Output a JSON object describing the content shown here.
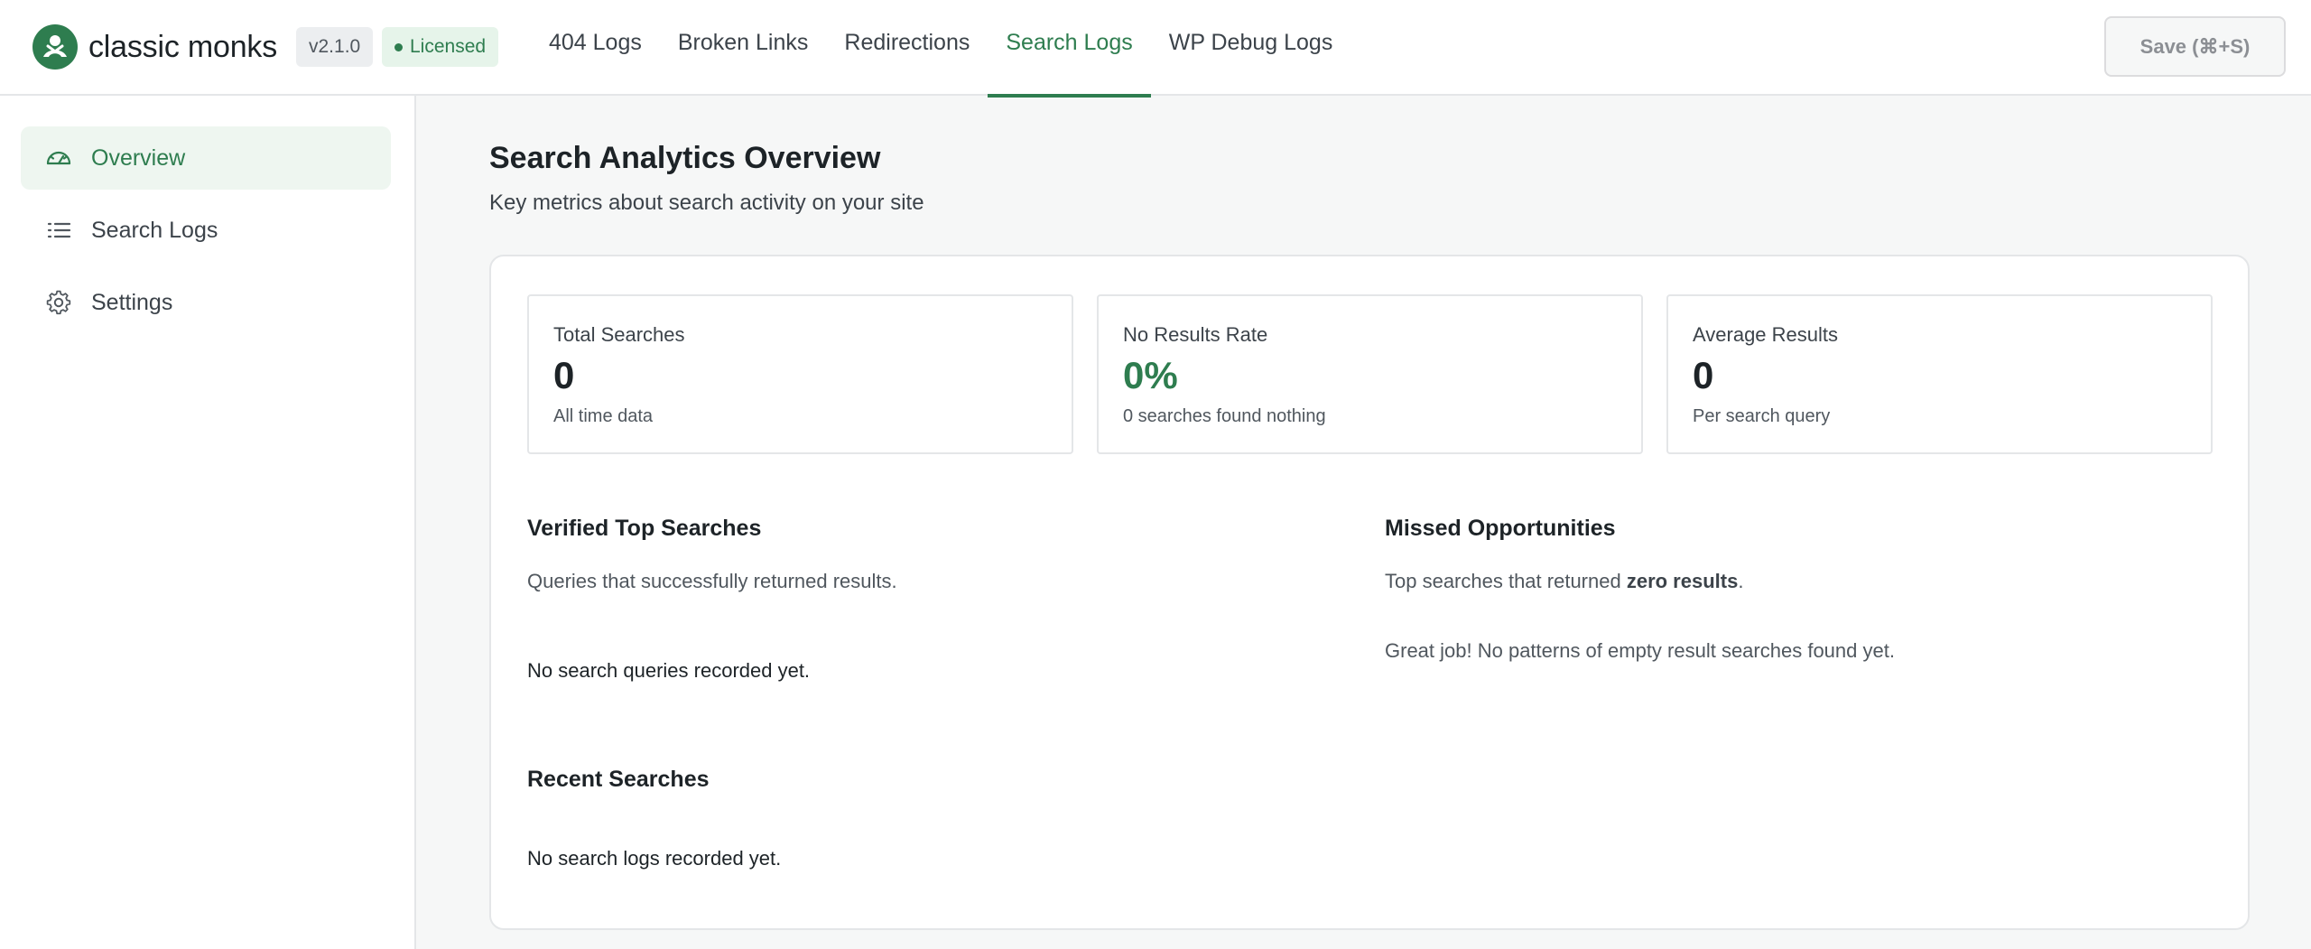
{
  "brand": {
    "name": "classic monks",
    "version": "v2.1.0",
    "license_status": "Licensed",
    "logo_icon": "monk-figure-icon"
  },
  "nav": {
    "tabs": [
      {
        "label": "404 Logs",
        "active": false
      },
      {
        "label": "Broken Links",
        "active": false
      },
      {
        "label": "Redirections",
        "active": false
      },
      {
        "label": "Search Logs",
        "active": true
      },
      {
        "label": "WP Debug Logs",
        "active": false
      }
    ],
    "save_label": "Save (⌘+S)"
  },
  "sidebar": {
    "items": [
      {
        "label": "Overview",
        "icon": "gauge-icon",
        "active": true
      },
      {
        "label": "Search Logs",
        "icon": "list-icon",
        "active": false
      },
      {
        "label": "Settings",
        "icon": "gear-icon",
        "active": false
      }
    ]
  },
  "main": {
    "title": "Search Analytics Overview",
    "subtitle": "Key metrics about search activity on your site",
    "stats": [
      {
        "label": "Total Searches",
        "value": "0",
        "note": "All time data"
      },
      {
        "label": "No Results Rate",
        "value": "0%",
        "note": "0 searches found nothing"
      },
      {
        "label": "Average Results",
        "value": "0",
        "note": "Per search query"
      }
    ],
    "top_searches": {
      "title": "Verified Top Searches",
      "description": "Queries that successfully returned results.",
      "empty": "No search queries recorded yet."
    },
    "missed": {
      "title": "Missed Opportunities",
      "description_prefix": "Top searches that returned ",
      "description_bold": "zero results",
      "description_suffix": ".",
      "empty": "Great job! No patterns of empty result searches found yet."
    },
    "recent": {
      "title": "Recent Searches",
      "empty": "No search logs recorded yet."
    }
  },
  "colors": {
    "accent": "#2e7d4f",
    "active_bg": "#eef6f0",
    "licensed_bg": "#e6f4ea"
  }
}
